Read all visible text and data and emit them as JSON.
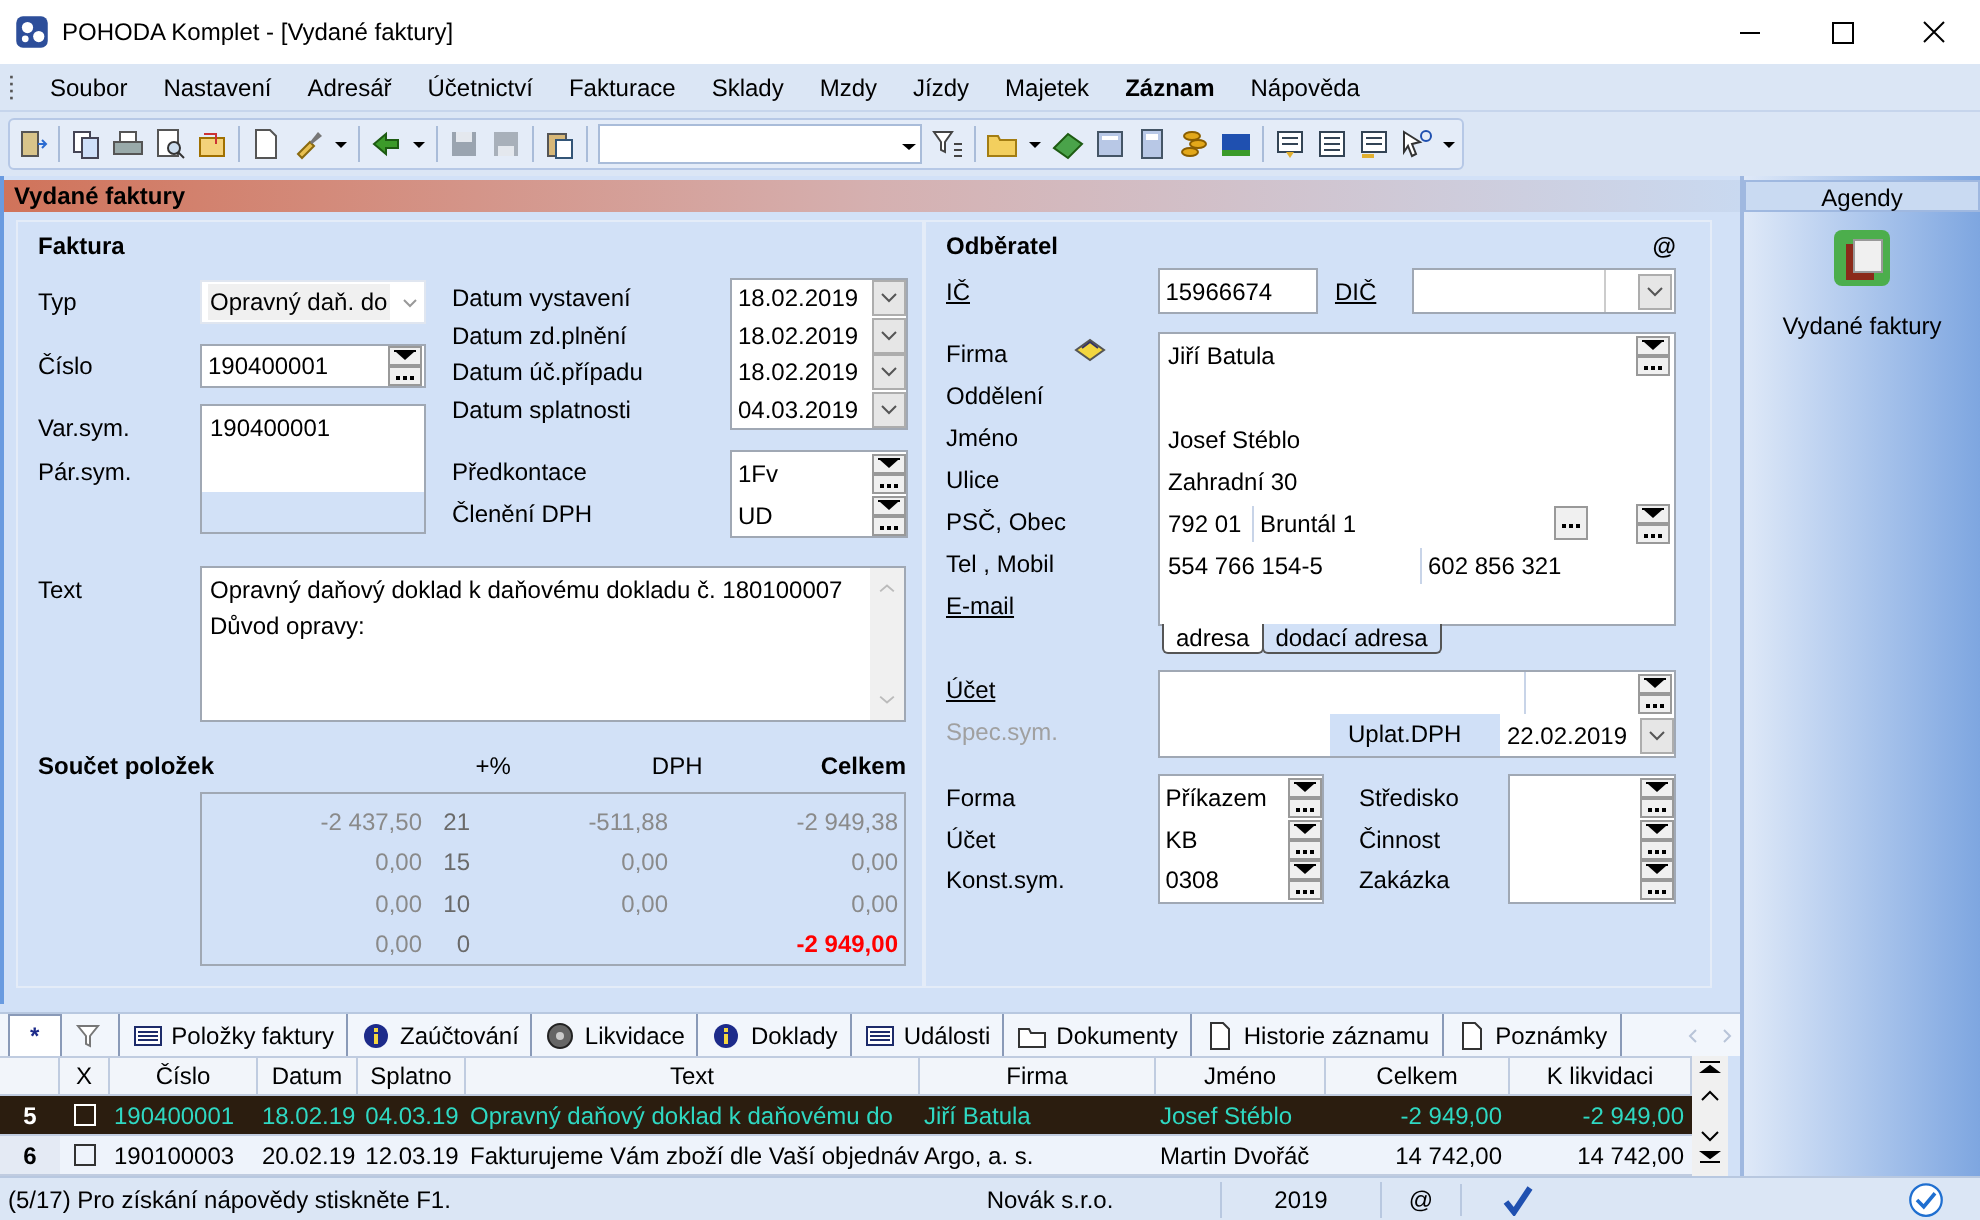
{
  "window": {
    "title": "POHODA Komplet - [Vydané faktury]"
  },
  "menu": [
    {
      "label": "Soubor",
      "bold": false
    },
    {
      "label": "Nastavení",
      "bold": false
    },
    {
      "label": "Adresář",
      "bold": false
    },
    {
      "label": "Účetnictví",
      "bold": false
    },
    {
      "label": "Fakturace",
      "bold": false
    },
    {
      "label": "Sklady",
      "bold": false
    },
    {
      "label": "Mzdy",
      "bold": false
    },
    {
      "label": "Jízdy",
      "bold": false
    },
    {
      "label": "Majetek",
      "bold": false
    },
    {
      "label": "Záznam",
      "bold": true
    },
    {
      "label": "Nápověda",
      "bold": false
    }
  ],
  "agenda_title": "Vydané faktury",
  "faktura": {
    "heading": "Faktura",
    "typ": {
      "label": "Typ",
      "value": "Opravný daň. do"
    },
    "cislo": {
      "label": "Číslo",
      "value": "190400001"
    },
    "symbols": {
      "labels": [
        "Var.sym.",
        "Pár.sym."
      ],
      "value": "190400001"
    },
    "dates": [
      {
        "label": "Datum vystavení",
        "value": "18.02.2019"
      },
      {
        "label": "Datum zd.plnění",
        "value": "18.02.2019"
      },
      {
        "label": "Datum úč.případu",
        "value": "18.02.2019"
      },
      {
        "label": "Datum splatnosti",
        "value": "04.03.2019"
      }
    ],
    "codes": [
      {
        "label": "Předkontace",
        "value": "1Fv"
      },
      {
        "label": "Členění DPH",
        "value": "UD"
      }
    ],
    "text": {
      "label": "Text",
      "lines": [
        "Opravný daňový doklad k daňovému dokladu č. 180100007",
        "Důvod opravy:"
      ]
    },
    "totals": {
      "heading": "Součet položek",
      "columns": [
        "+%",
        "DPH",
        "Celkem"
      ],
      "rows": [
        {
          "base": "-2 437,50",
          "rate": "21",
          "vat": "-511,88",
          "total": "-2 949,38",
          "emphasis": false
        },
        {
          "base": "0,00",
          "rate": "15",
          "vat": "0,00",
          "total": "0,00",
          "emphasis": false
        },
        {
          "base": "0,00",
          "rate": "10",
          "vat": "0,00",
          "total": "0,00",
          "emphasis": false
        },
        {
          "base": "0,00",
          "rate": "0",
          "total": "-2 949,00",
          "emphasis": true
        }
      ]
    }
  },
  "odberatel": {
    "heading": "Odběratel",
    "mail_mark": "@",
    "ic": {
      "label": "IČ",
      "value": "15966674",
      "link": true
    },
    "dic": {
      "label": "DIČ",
      "link": true
    },
    "address_labels": [
      {
        "text": "Firma",
        "link": false
      },
      {
        "text": "Oddělení",
        "link": false
      },
      {
        "text": "Jméno",
        "link": false
      },
      {
        "text": "Ulice",
        "link": false
      },
      {
        "text": "PSČ, Obec",
        "link": false
      },
      {
        "text": "Tel ,  Mobil",
        "link": false
      },
      {
        "text": "E-mail",
        "link": true
      }
    ],
    "address": {
      "firma": "Jiří Batula",
      "jmeno": "Josef Stéblo",
      "ulice": "Zahradní 30",
      "psc": "792 01",
      "obec": "Bruntál 1",
      "tel": "554 766 154-5",
      "mobil": "602 856 321"
    },
    "address_tabs": [
      {
        "label": "adresa",
        "selected": true
      },
      {
        "label": "dodací adresa",
        "selected": false
      }
    ],
    "ucet": {
      "label": "Účet",
      "link": true
    },
    "spec_sym": {
      "label": "Spec.sym.",
      "disabled": true
    },
    "uplat_dph": {
      "label": "Uplat.DPH",
      "value": "22.02.2019"
    },
    "payment": [
      {
        "label": "Forma",
        "value": "Příkazem"
      },
      {
        "label": "Účet",
        "value": "KB"
      },
      {
        "label": "Konst.sym.",
        "value": "0308"
      }
    ],
    "assignments": [
      {
        "label": "Středisko"
      },
      {
        "label": "Činnost"
      },
      {
        "label": "Zakázka"
      }
    ]
  },
  "agendas": {
    "title": "Agendy",
    "items": [
      {
        "label": "Vydané faktury"
      }
    ]
  },
  "detail_tabs": [
    {
      "label": "*",
      "selected": true
    },
    {
      "selected": false
    },
    {
      "label": "Položky faktury",
      "selected": false
    },
    {
      "label": "Zaúčtování",
      "selected": false
    },
    {
      "label": "Likvidace",
      "selected": false
    },
    {
      "label": "Doklady",
      "selected": false
    },
    {
      "label": "Události",
      "selected": false
    },
    {
      "label": "Dokumenty",
      "selected": false
    },
    {
      "label": "Historie záznamu",
      "selected": false
    },
    {
      "label": "Poznámky",
      "selected": false
    }
  ],
  "table": {
    "check_column": "X",
    "columns": [
      "Číslo",
      "Datum",
      "Splatno",
      "Text",
      "Firma",
      "Jméno",
      "Celkem",
      "K likvidaci"
    ],
    "rows": [
      {
        "num": "5",
        "selected": true,
        "checked": false,
        "cells": [
          "190400001",
          "18.02.19",
          "04.03.19",
          "Opravný daňový doklad k daňovému do",
          "Jiří Batula",
          "Josef Stéblo",
          "-2 949,00",
          "-2 949,00"
        ]
      },
      {
        "num": "6",
        "selected": false,
        "checked": false,
        "cells": [
          "190100003",
          "20.02.19",
          "12.03.19",
          "Fakturujeme Vám zboží dle Vaší objednáv",
          "Argo, a. s.",
          "Martin Dvořáč",
          "14 742,00",
          "14 742,00"
        ]
      }
    ]
  },
  "status_bar": {
    "hint": "(5/17) Pro získání nápovědy stiskněte F1.",
    "company": "Novák s.r.o.",
    "year": "2019",
    "mail": "@"
  }
}
